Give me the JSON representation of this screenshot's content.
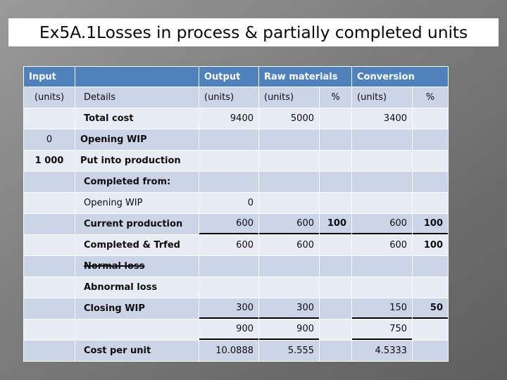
{
  "slide": {
    "title": "Ex5A.1Losses in process & partially completed units",
    "header_color": "#4F81BD",
    "row_light": "#E8ECF4",
    "row_dark": "#CCD5E8"
  },
  "table": {
    "group_headers": {
      "input": "Input",
      "details": "",
      "output": "Output",
      "raw_materials": "Raw materials",
      "conversion": "Conversion"
    },
    "sub_headers": {
      "input_units": "(units)",
      "details": "Details",
      "output_units": "(units)",
      "rm_units": "(units)",
      "rm_pct": "%",
      "cv_units": "(units)",
      "cv_pct": "%"
    },
    "rows": [
      {
        "input": "",
        "details": "Total cost",
        "details_style": "bold",
        "output": "9400",
        "rm_units": "5000",
        "rm_pct": "",
        "cv_units": "3400",
        "cv_pct": "",
        "shade": "light",
        "indent": true
      },
      {
        "input": "0",
        "details": "Opening WIP",
        "details_style": "bold",
        "output": "",
        "rm_units": "",
        "rm_pct": "",
        "cv_units": "",
        "cv_pct": "",
        "shade": "dark",
        "indent": false
      },
      {
        "input": "1 000",
        "input_style": "bold",
        "details": "Put into production",
        "details_style": "bold",
        "output": "",
        "rm_units": "",
        "rm_pct": "",
        "cv_units": "",
        "cv_pct": "",
        "shade": "light",
        "indent": false
      },
      {
        "input": "",
        "details": "Completed from:",
        "details_style": "bold",
        "output": "",
        "rm_units": "",
        "rm_pct": "",
        "cv_units": "",
        "cv_pct": "",
        "shade": "dark",
        "indent": true
      },
      {
        "input": "",
        "details": "Opening WIP",
        "details_style": "normal",
        "output": "0",
        "rm_units": "",
        "rm_pct": "",
        "cv_units": "",
        "cv_pct": "",
        "shade": "light",
        "indent": true
      },
      {
        "input": "",
        "details": "Current production",
        "details_style": "bold",
        "output": "600",
        "rm_units": "600",
        "rm_pct": "100",
        "cv_units": "600",
        "cv_pct": "100",
        "shade": "dark",
        "indent": true,
        "underline": true
      },
      {
        "input": "",
        "details": "Completed & Trfed",
        "details_style": "bold",
        "output": "600",
        "rm_units": "600",
        "rm_pct": "",
        "cv_units": "600",
        "cv_pct": "100",
        "shade": "light",
        "indent": true
      },
      {
        "input": "",
        "details": "Normal loss",
        "details_style": "strike",
        "output": "",
        "rm_units": "",
        "rm_pct": "",
        "cv_units": "",
        "cv_pct": "",
        "shade": "dark",
        "indent": true
      },
      {
        "input": "",
        "details": "Abnormal loss",
        "details_style": "bold",
        "output": "",
        "rm_units": "",
        "rm_pct": "",
        "cv_units": "",
        "cv_pct": "",
        "shade": "light",
        "indent": true
      },
      {
        "input": "",
        "details": "Closing WIP",
        "details_style": "bold",
        "output": "300",
        "rm_units": "300",
        "rm_pct": "",
        "cv_units": "150",
        "cv_pct": "50",
        "shade": "dark",
        "indent": true,
        "underline": true
      },
      {
        "input": "",
        "details": "",
        "details_style": "normal",
        "output": "900",
        "rm_units": "900",
        "rm_pct": "",
        "cv_units": "750",
        "cv_pct": "",
        "shade": "light",
        "indent": true,
        "underline": true
      },
      {
        "input": "",
        "details": "Cost per unit",
        "details_style": "bold",
        "output": "10.0888",
        "rm_units": "5.555",
        "rm_pct": "",
        "cv_units": "4.5333",
        "cv_pct": "",
        "shade": "dark",
        "indent": true
      }
    ]
  }
}
